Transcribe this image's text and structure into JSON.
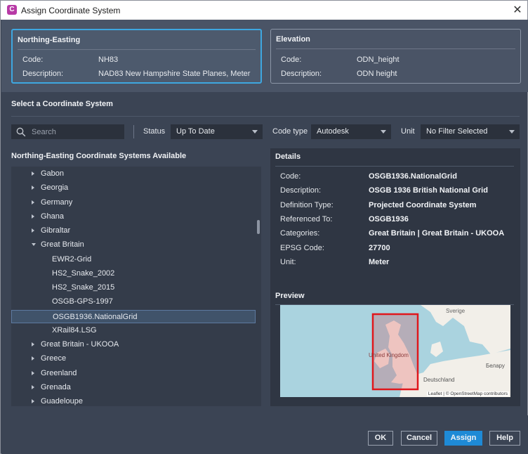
{
  "window": {
    "title": "Assign Coordinate System",
    "app_icon": "C",
    "close_glyph": "✕"
  },
  "northing_easting": {
    "title": "Northing-Easting",
    "code_label": "Code:",
    "code_value": "NH83",
    "description_label": "Description:",
    "description_value": "NAD83 New Hampshire State Planes, Meter"
  },
  "elevation": {
    "title": "Elevation",
    "code_label": "Code:",
    "code_value": "ODN_height",
    "description_label": "Description:",
    "description_value": "ODN height"
  },
  "select_section": {
    "title": "Select a Coordinate System"
  },
  "filters": {
    "search_placeholder": "Search",
    "status_label": "Status",
    "status_value": "Up To Date",
    "code_type_label": "Code type",
    "code_type_value": "Autodesk",
    "unit_label": "Unit",
    "unit_value": "No Filter Selected"
  },
  "list": {
    "title": "Northing-Easting Coordinate Systems Available",
    "items": [
      {
        "label": "Gabon",
        "level": 0,
        "state": "collapsed"
      },
      {
        "label": "Georgia",
        "level": 0,
        "state": "collapsed"
      },
      {
        "label": "Germany",
        "level": 0,
        "state": "collapsed"
      },
      {
        "label": "Ghana",
        "level": 0,
        "state": "collapsed"
      },
      {
        "label": "Gibraltar",
        "level": 0,
        "state": "collapsed"
      },
      {
        "label": "Great Britain",
        "level": 0,
        "state": "expanded"
      },
      {
        "label": "EWR2-Grid",
        "level": 1,
        "state": "leaf"
      },
      {
        "label": "HS2_Snake_2002",
        "level": 1,
        "state": "leaf"
      },
      {
        "label": "HS2_Snake_2015",
        "level": 1,
        "state": "leaf"
      },
      {
        "label": "OSGB-GPS-1997",
        "level": 1,
        "state": "leaf"
      },
      {
        "label": "OSGB1936.NationalGrid",
        "level": 1,
        "state": "leaf",
        "selected": true
      },
      {
        "label": "XRail84.LSG",
        "level": 1,
        "state": "leaf"
      },
      {
        "label": "Great Britain - UKOOA",
        "level": 0,
        "state": "collapsed"
      },
      {
        "label": "Greece",
        "level": 0,
        "state": "collapsed"
      },
      {
        "label": "Greenland",
        "level": 0,
        "state": "collapsed"
      },
      {
        "label": "Grenada",
        "level": 0,
        "state": "collapsed"
      },
      {
        "label": "Guadeloupe",
        "level": 0,
        "state": "collapsed"
      }
    ]
  },
  "details": {
    "title": "Details",
    "rows": [
      {
        "label": "Code:",
        "value": "OSGB1936.NationalGrid"
      },
      {
        "label": "Description:",
        "value": "OSGB 1936 British National Grid"
      },
      {
        "label": "Definition Type:",
        "value": "Projected Coordinate System"
      },
      {
        "label": "Referenced To:",
        "value": "OSGB1936"
      },
      {
        "label": "Categories:",
        "value": "Great Britain | Great Britain - UKOOA"
      },
      {
        "label": "EPSG Code:",
        "value": "27700"
      },
      {
        "label": "Unit:",
        "value": "Meter"
      }
    ],
    "preview_title": "Preview",
    "map_labels": {
      "sverige": "Sverige",
      "uk": "United Kingdom",
      "deutschland": "Deutschland",
      "belarus": "Белару"
    },
    "attribution": "Leaflet | © OpenStreetMap contributors",
    "colors": {
      "water": "#aad3df",
      "land": "#f2efe9",
      "extent": "#e0171c"
    }
  },
  "buttons": {
    "ok": "OK",
    "cancel": "Cancel",
    "assign": "Assign",
    "help": "Help"
  }
}
